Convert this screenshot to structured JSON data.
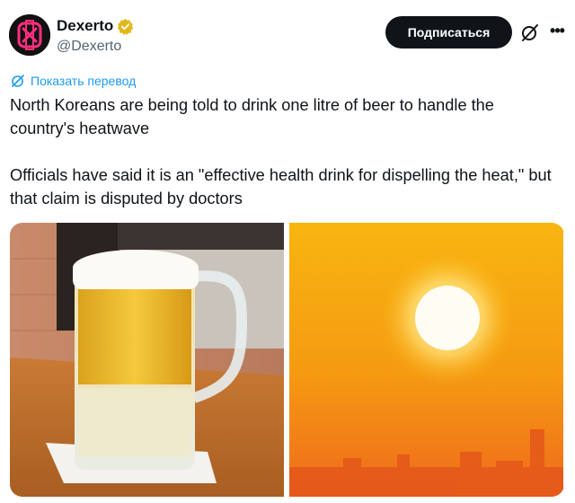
{
  "author": {
    "display_name": "Dexerto",
    "handle": "@Dexerto",
    "avatar_icon": "dexerto-logo-icon",
    "verified_icon": "verified-badge-icon"
  },
  "actions": {
    "subscribe_label": "Подписаться",
    "grok_icon": "grok-icon",
    "more_icon": "more-options-icon",
    "more_glyph": "•••"
  },
  "translate": {
    "label": "Показать перевод",
    "icon": "globe-icon"
  },
  "tweet": {
    "paragraph_1": "North Koreans are being told to drink one litre of beer to handle the country's heatwave",
    "paragraph_2": "Officials have said it is an \"effective health drink for dispelling the heat,\" but that claim is disputed by doctors"
  },
  "media": [
    {
      "description_icon": "beer-mug-photo"
    },
    {
      "description_icon": "sunset-sun-photo"
    }
  ],
  "colors": {
    "link": "#1d9bf0",
    "text": "#0f1419",
    "muted": "#536471",
    "button_bg": "#0f1419",
    "verified_gold": "#e2b719",
    "brand_pink": "#ff2e7e"
  }
}
